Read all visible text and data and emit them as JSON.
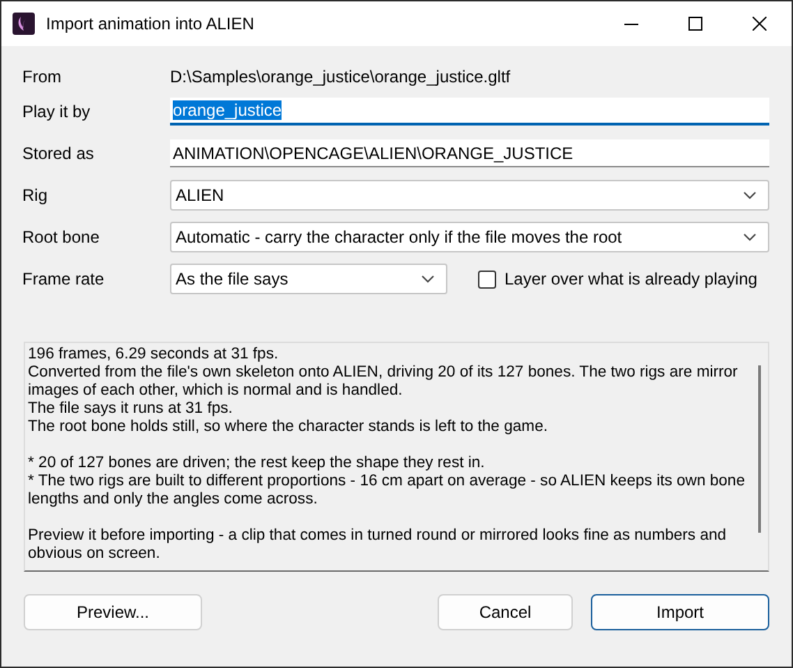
{
  "window": {
    "title": "Import animation into ALIEN"
  },
  "form": [
    {
      "kind": "text",
      "label": "From",
      "value": "D:\\Samples\\orange_justice\\orange_justice.gltf"
    },
    {
      "kind": "input",
      "label": "Play it by",
      "value": "orange_justice",
      "focused": true
    },
    {
      "kind": "input",
      "label": "Stored as",
      "value": "ANIMATION\\OPENCAGE\\ALIEN\\ORANGE_JUSTICE",
      "focused": false
    },
    {
      "kind": "combo",
      "label": "Rig",
      "value": "ALIEN"
    },
    {
      "kind": "combo",
      "label": "Root bone",
      "value": "Automatic - carry the character only if the file moves the root"
    },
    {
      "kind": "combo_check",
      "label": "Frame rate",
      "value": "As the file says",
      "check_label": "Layer over what is already playing",
      "checked": false
    }
  ],
  "report": [
    [
      "196 frames, 6.29 seconds at 31 fps.",
      "Converted from the file's own skeleton onto ALIEN, driving 20 of its 127 bones. The two rigs are mirror images of each other, which is normal and is handled.",
      "The file says it runs at 31 fps.",
      "The root bone holds still, so where the character stands is left to the game."
    ],
    [
      "* 20 of 127 bones are driven; the rest keep the shape they rest in.",
      "* The two rigs are built to different proportions - 16 cm apart on average - so ALIEN keeps its own bone lengths and only the angles come across."
    ],
    [
      "Preview it before importing - a clip that comes in turned round or mirrored looks fine as numbers and obvious on screen."
    ]
  ],
  "buttons": [
    {
      "label": "Preview...",
      "default": false
    },
    {
      "label": "Cancel",
      "default": false
    },
    {
      "label": "Import",
      "default": true
    }
  ]
}
